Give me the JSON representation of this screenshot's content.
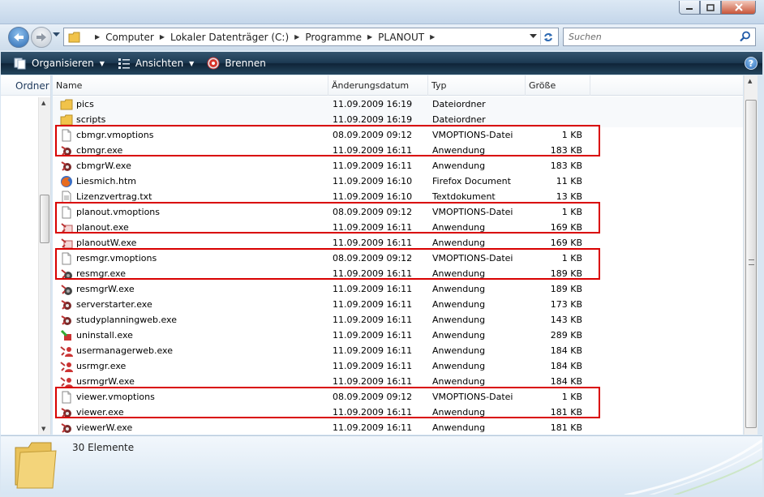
{
  "breadcrumb": [
    "Computer",
    "Lokaler Datenträger (C:)",
    "Programme",
    "PLANOUT"
  ],
  "search": {
    "placeholder": "Suchen"
  },
  "toolbar": {
    "organize": "Organisieren",
    "views": "Ansichten",
    "burn": "Brennen",
    "help": "?"
  },
  "leftpane": {
    "label": "Ordner"
  },
  "columns": {
    "name": "Name",
    "date": "Änderungsdatum",
    "type": "Typ",
    "size": "Größe"
  },
  "files": [
    {
      "name": "pics",
      "date": "11.09.2009 16:19",
      "type": "Dateiordner",
      "size": "",
      "icon": "folder-icon"
    },
    {
      "name": "scripts",
      "date": "11.09.2009 16:19",
      "type": "Dateiordner",
      "size": "",
      "icon": "folder-icon"
    },
    {
      "name": "cbmgr.vmoptions",
      "date": "08.09.2009 09:12",
      "type": "VMOPTIONS-Datei",
      "size": "1 KB",
      "icon": "document-icon"
    },
    {
      "name": "cbmgr.exe",
      "date": "11.09.2009 16:11",
      "type": "Anwendung",
      "size": "183 KB",
      "icon": "gear-app-icon"
    },
    {
      "name": "cbmgrW.exe",
      "date": "11.09.2009 16:11",
      "type": "Anwendung",
      "size": "183 KB",
      "icon": "gear-app-icon"
    },
    {
      "name": "Liesmich.htm",
      "date": "11.09.2009 16:10",
      "type": "Firefox Document",
      "size": "11 KB",
      "icon": "firefox-icon"
    },
    {
      "name": "Lizenzvertrag.txt",
      "date": "11.09.2009 16:10",
      "type": "Textdokument",
      "size": "13 KB",
      "icon": "text-document-icon"
    },
    {
      "name": "planout.vmoptions",
      "date": "08.09.2009 09:12",
      "type": "VMOPTIONS-Datei",
      "size": "1 KB",
      "icon": "document-icon"
    },
    {
      "name": "planout.exe",
      "date": "11.09.2009 16:11",
      "type": "Anwendung",
      "size": "169 KB",
      "icon": "planout-app-icon"
    },
    {
      "name": "planoutW.exe",
      "date": "11.09.2009 16:11",
      "type": "Anwendung",
      "size": "169 KB",
      "icon": "planout-app-icon"
    },
    {
      "name": "resmgr.vmoptions",
      "date": "08.09.2009 09:12",
      "type": "VMOPTIONS-Datei",
      "size": "1 KB",
      "icon": "document-icon"
    },
    {
      "name": "resmgr.exe",
      "date": "11.09.2009 16:11",
      "type": "Anwendung",
      "size": "189 KB",
      "icon": "resource-app-icon"
    },
    {
      "name": "resmgrW.exe",
      "date": "11.09.2009 16:11",
      "type": "Anwendung",
      "size": "189 KB",
      "icon": "resource-app-icon"
    },
    {
      "name": "serverstarter.exe",
      "date": "11.09.2009 16:11",
      "type": "Anwendung",
      "size": "173 KB",
      "icon": "gear-app-icon"
    },
    {
      "name": "studyplanningweb.exe",
      "date": "11.09.2009 16:11",
      "type": "Anwendung",
      "size": "143 KB",
      "icon": "gear-app-icon"
    },
    {
      "name": "uninstall.exe",
      "date": "11.09.2009 16:11",
      "type": "Anwendung",
      "size": "289 KB",
      "icon": "uninstall-app-icon"
    },
    {
      "name": "usermanagerweb.exe",
      "date": "11.09.2009 16:11",
      "type": "Anwendung",
      "size": "184 KB",
      "icon": "user-app-icon"
    },
    {
      "name": "usrmgr.exe",
      "date": "11.09.2009 16:11",
      "type": "Anwendung",
      "size": "184 KB",
      "icon": "user-app-icon"
    },
    {
      "name": "usrmgrW.exe",
      "date": "11.09.2009 16:11",
      "type": "Anwendung",
      "size": "184 KB",
      "icon": "user-app-icon"
    },
    {
      "name": "viewer.vmoptions",
      "date": "08.09.2009 09:12",
      "type": "VMOPTIONS-Datei",
      "size": "1 KB",
      "icon": "document-icon"
    },
    {
      "name": "viewer.exe",
      "date": "11.09.2009 16:11",
      "type": "Anwendung",
      "size": "181 KB",
      "icon": "gear-app-icon"
    },
    {
      "name": "viewerW.exe",
      "date": "11.09.2009 16:11",
      "type": "Anwendung",
      "size": "181 KB",
      "icon": "gear-app-icon"
    }
  ],
  "status": {
    "count": "30 Elemente"
  },
  "colors": {
    "highlight": "#d90000",
    "commandbar": "#1d3a53"
  }
}
